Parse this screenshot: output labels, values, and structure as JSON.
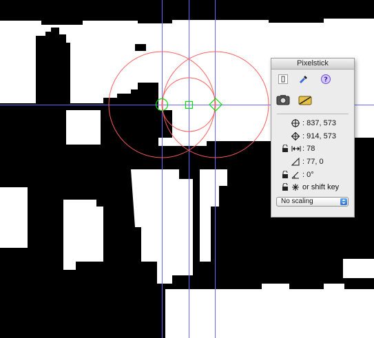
{
  "window": {
    "title": "Pixelstick"
  },
  "tools": [
    {
      "name": "pointer-icon"
    },
    {
      "name": "eyedropper-icon"
    },
    {
      "name": "help-icon"
    },
    {
      "name": "camera-icon"
    },
    {
      "name": "ruler-camera-icon"
    }
  ],
  "readouts": {
    "start_point": ": 837, 573",
    "end_point": ": 914, 573",
    "distance": ": 78",
    "delta": ": 77, 0",
    "angle": ": 0°",
    "constraint": "or shift key"
  },
  "scaling": {
    "selected": "No scaling"
  },
  "colors": {
    "background": "#ffffff",
    "pixels": "#000000",
    "guide_lines": "#6666ff",
    "circles": "#ff5c5c",
    "handles": "#00dd00"
  }
}
